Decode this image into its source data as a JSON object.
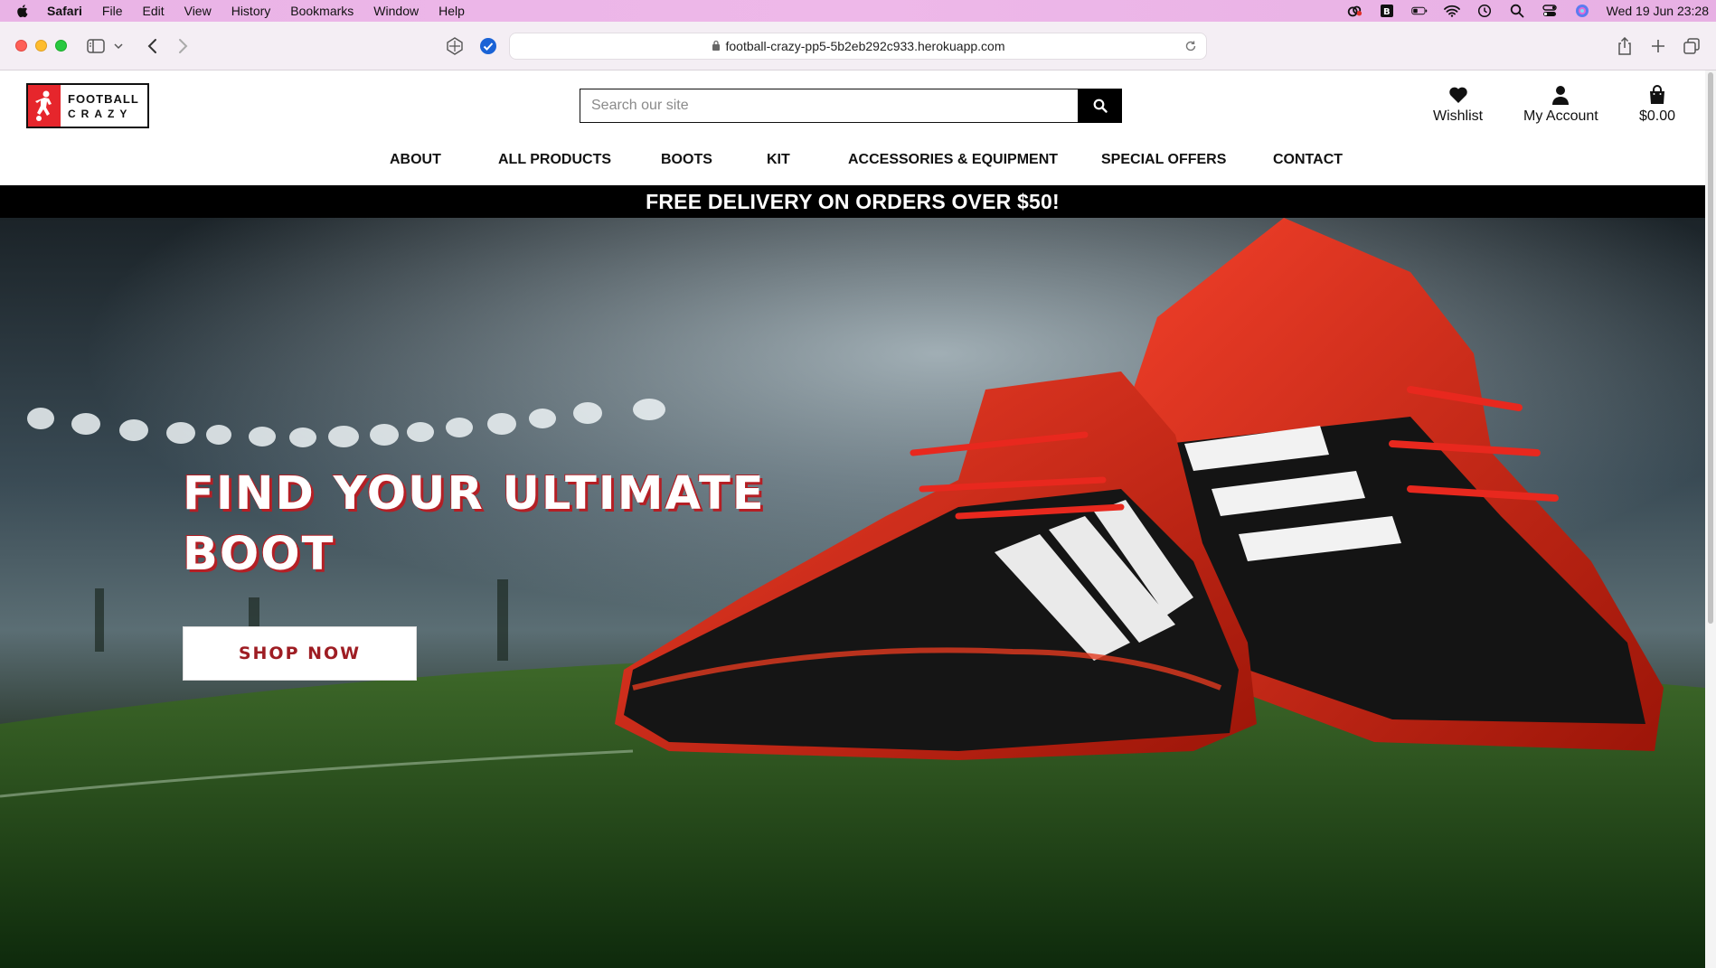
{
  "menubar": {
    "app": "Safari",
    "items": [
      "File",
      "Edit",
      "View",
      "History",
      "Bookmarks",
      "Window",
      "Help"
    ],
    "clock": "Wed 19 Jun  23:28"
  },
  "browser": {
    "url": "football-crazy-pp5-5b2eb292c933.herokuapp.com"
  },
  "header": {
    "logo_line1": "FOOTBALL",
    "logo_line2": "CRAZY",
    "search_placeholder": "Search our site",
    "wishlist": "Wishlist",
    "account": "My Account",
    "bag_total": "$0.00"
  },
  "nav": {
    "items": [
      "ABOUT",
      "ALL PRODUCTS",
      "BOOTS",
      "KIT",
      "ACCESSORIES & EQUIPMENT",
      "SPECIAL OFFERS",
      "CONTACT"
    ]
  },
  "promo": {
    "text": "FREE DELIVERY ON ORDERS OVER $50!"
  },
  "hero": {
    "heading_line1": "FIND YOUR ULTIMATE",
    "heading_line2": "BOOT",
    "cta": "SHOP NOW"
  },
  "colors": {
    "brand_red": "#e6262c",
    "cta_text": "#9e1d23",
    "promo_bg": "#000000"
  }
}
